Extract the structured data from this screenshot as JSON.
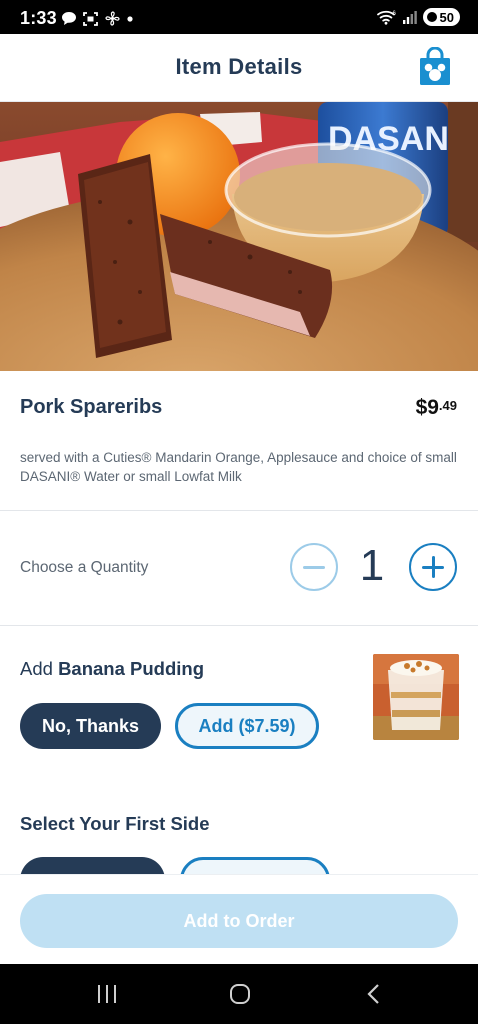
{
  "status_bar": {
    "time": "1:33",
    "battery": "50",
    "left_icons": [
      "chat-icon",
      "screenshot-icon",
      "fan-icon",
      "dot-icon"
    ],
    "right_icons": [
      "wifi-icon",
      "signal-icon",
      "battery-icon"
    ]
  },
  "header": {
    "title": "Item Details",
    "bag_icon": "mickey-shopping-bag-icon"
  },
  "item": {
    "name": "Pork Spareribs",
    "price_dollars": "$9",
    "price_cents": ".49",
    "description": "served with a Cuties® Mandarin Orange, Applesauce and choice of small DASANI® Water or small Lowfat Milk",
    "image_label": "DASANI"
  },
  "quantity": {
    "label": "Choose a Quantity",
    "value": "1"
  },
  "addon": {
    "prefix": "Add",
    "name": "Banana Pudding",
    "no_label": "No, Thanks",
    "add_label": "Add ($7.59)"
  },
  "side": {
    "title": "Select Your First Side"
  },
  "footer": {
    "add_to_order_label": "Add to Order"
  },
  "colors": {
    "navy": "#253b56",
    "accent_blue": "#1a7fc1",
    "disabled_blue": "#bfe0f3",
    "text_gray": "#5c6773"
  },
  "nav_bar": {
    "icons": [
      "recents-icon",
      "home-icon",
      "back-icon"
    ]
  }
}
